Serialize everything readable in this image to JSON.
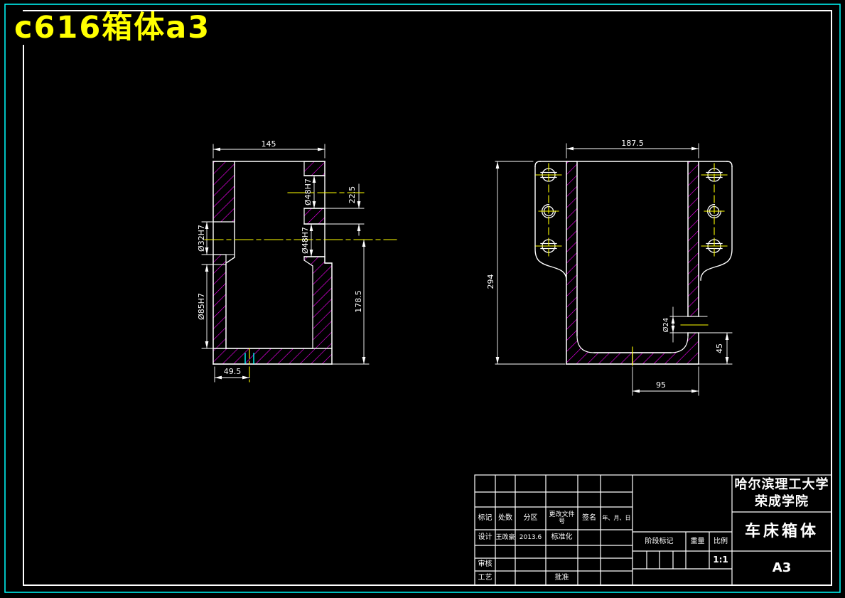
{
  "page": {
    "title": "c616箱体a3"
  },
  "colors": {
    "background": "#000000",
    "outline": "#ffffff",
    "hatch": "#ff00ff",
    "centerline": "#ffff00",
    "border_frame": "#00ffff",
    "title_text": "#ffff00"
  },
  "left_view": {
    "dim_width": "145",
    "dim_bore_upper": "Ø48H7",
    "dim_bore_lower": "Ø48H7",
    "dim_bore_left": "Ø32H7",
    "dim_bore_main": "Ø85H7",
    "dim_step": "22.5",
    "dim_height": "178.5",
    "dim_base": "49.5"
  },
  "right_view": {
    "dim_width": "187.5",
    "dim_height": "294",
    "dim_hole": "Ø24",
    "dim_hole_height": "45",
    "dim_base_width": "95"
  },
  "title_block": {
    "school_line1": "哈尔滨理工大学",
    "school_line2": "荣成学院",
    "drawing_title": "车床箱体",
    "sheet_size": "A3",
    "scale_value": "1:1",
    "headers": {
      "mark": "标记",
      "count": "处数",
      "zone": "分区",
      "change_doc": "更改文件号",
      "signature": "签名",
      "date": "年、月、日",
      "stage_mark": "阶段标记",
      "weight": "重量",
      "scale": "比例"
    },
    "cells": {
      "design": "设计",
      "designer": "王政豪",
      "design_date": "2013.6",
      "standardize": "标准化",
      "review": "审核",
      "process": "工艺",
      "approve": "批准"
    }
  }
}
